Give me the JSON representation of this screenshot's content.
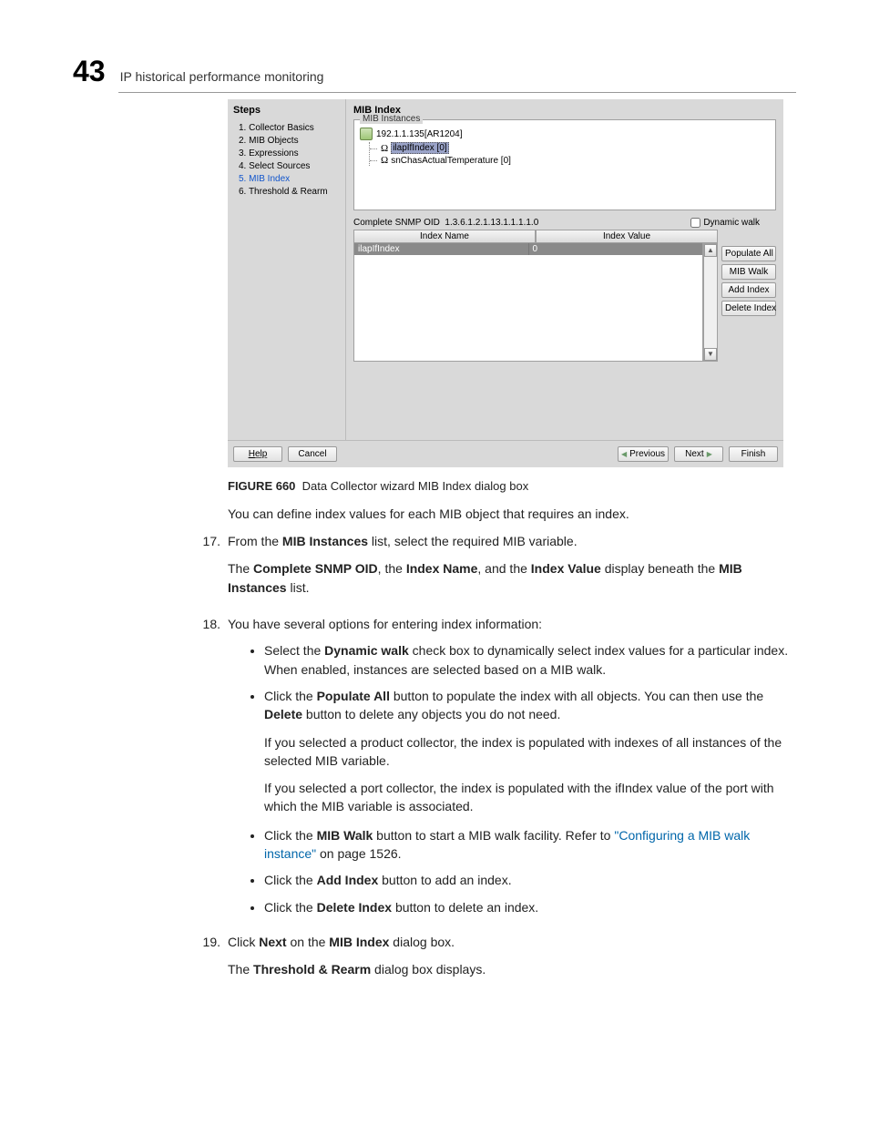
{
  "header": {
    "chapter_number": "43",
    "chapter_title": "IP historical performance monitoring"
  },
  "dialog": {
    "steps_title": "Steps",
    "steps": [
      "1. Collector Basics",
      "2. MIB Objects",
      "3. Expressions",
      "4. Select Sources",
      "5. MIB Index",
      "6. Threshold & Rearm"
    ],
    "active_step_index": 4,
    "main_title": "MIB Index",
    "instances_legend": "MIB Instances",
    "tree_root": "192.1.1.135[AR1204]",
    "tree_items": [
      {
        "label": "ilapIfIndex [0]",
        "selected": true
      },
      {
        "label": "snChasActualTemperature [0]",
        "selected": false
      }
    ],
    "oid_label": "Complete SNMP OID",
    "oid_value": "1.3.6.1.2.1.13.1.1.1.1.0",
    "dynamic_walk_label": "Dynamic walk",
    "col_index_name": "Index Name",
    "col_index_value": "Index Value",
    "row_name": "ilapIfIndex",
    "row_value": "0",
    "buttons": {
      "populate_all": "Populate All",
      "mib_walk": "MIB Walk",
      "add_index": "Add Index",
      "delete_index": "Delete Index",
      "help": "Help",
      "cancel": "Cancel",
      "previous": "Previous",
      "next": "Next",
      "finish": "Finish"
    }
  },
  "caption": {
    "label": "FIGURE 660",
    "text": "Data Collector wizard MIB Index dialog box"
  },
  "body": {
    "p_intro": "You can define index values for each MIB object that requires an index.",
    "s17_num": "17.",
    "s17a": "From the ",
    "s17b": "MIB Instances",
    "s17c": " list, select the required MIB variable.",
    "s17_p2a": "The ",
    "s17_p2b": "Complete SNMP OID",
    "s17_p2c": ", the ",
    "s17_p2d": "Index Name",
    "s17_p2e": ", and the ",
    "s17_p2f": "Index Value",
    "s17_p2g": " display beneath the ",
    "s17_p2h": "MIB Instances",
    "s17_p2i": " list.",
    "s18_num": "18.",
    "s18": "You have several options for entering index information:",
    "b1a": "Select the ",
    "b1b": "Dynamic walk",
    "b1c": " check box to dynamically select index values for a particular index. When enabled, instances are selected based on a MIB walk.",
    "b2a": "Click the ",
    "b2b": "Populate All",
    "b2c": " button to populate the index with all objects. You can then use the ",
    "b2d": "Delete",
    "b2e": " button to delete any objects you do not need.",
    "b2p2": "If you selected a product collector, the index is populated with indexes of all instances of the selected MIB variable.",
    "b2p3": "If you selected a port collector, the index is populated with the ifIndex value of the port with which the MIB variable is associated.",
    "b3a": "Click the ",
    "b3b": "MIB Walk",
    "b3c": " button to start a MIB walk facility. Refer to ",
    "b3link": "\"Configuring a MIB walk instance\"",
    "b3d": " on page 1526.",
    "b4a": "Click the ",
    "b4b": "Add Index",
    "b4c": " button to add an index.",
    "b5a": "Click the ",
    "b5b": "Delete Index",
    "b5c": " button to delete an index.",
    "s19_num": "19.",
    "s19a": "Click ",
    "s19b": "Next",
    "s19c": " on the ",
    "s19d": "MIB Index",
    "s19e": " dialog box.",
    "s19p2a": "The ",
    "s19p2b": "Threshold & Rearm",
    "s19p2c": " dialog box displays."
  }
}
